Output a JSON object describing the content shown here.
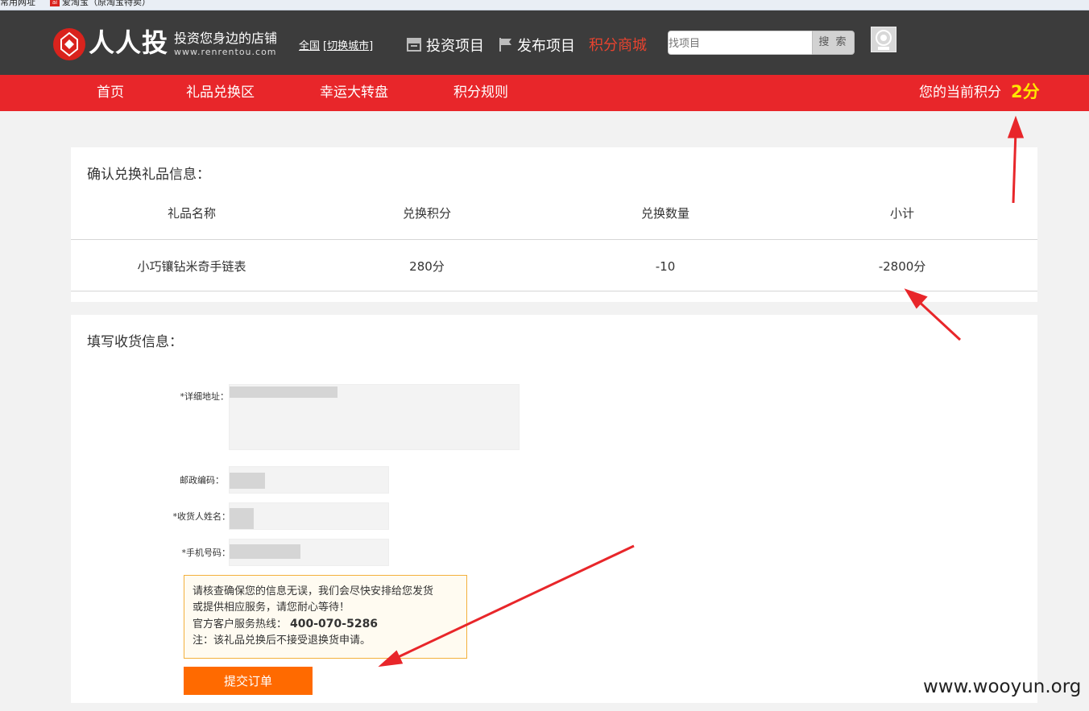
{
  "bookmarks": {
    "items": [
      {
        "label": "常用网址",
        "icon": "folder-icon"
      },
      {
        "label": "爱淘宝（原淘宝特卖）",
        "icon": "ai-taobao-icon"
      }
    ]
  },
  "header": {
    "logo_name": "人人投",
    "logo_slogan": "投资您身边的店铺",
    "logo_url": "www.renrentou.com",
    "city_current": "全国",
    "city_switch": "[切换城市]",
    "nav": [
      {
        "label": "投资项目",
        "icon": "shop-icon"
      },
      {
        "label": "发布项目",
        "icon": "flag-icon"
      },
      {
        "label": "积分商城",
        "active_color": "#e8432f"
      }
    ],
    "search_placeholder": "找项目",
    "search_button": "搜 索"
  },
  "rednav": {
    "items": [
      "首页",
      "礼品兑换区",
      "幸运大转盘",
      "积分规则"
    ],
    "points_label": "您的当前积分",
    "points_value": "2分",
    "bg_color": "#e8262a"
  },
  "confirm": {
    "title": "确认兑换礼品信息：",
    "columns": [
      "礼品名称",
      "兑换积分",
      "兑换数量",
      "小计"
    ],
    "rows": [
      [
        "小巧镶钻米奇手链表",
        "280分",
        "-10",
        "-2800分"
      ]
    ]
  },
  "shipping": {
    "title": "填写收货信息：",
    "fields": {
      "address_label": "*详细地址：",
      "zip_label": "邮政编码：",
      "name_label": "*收货人姓名：",
      "phone_label": "*手机号码："
    },
    "notice": {
      "line1": "请核查确保您的信息无误，我们会尽快安排给您发货",
      "line2": "或提供相应服务，请您耐心等待！",
      "hotline_label": "官方客户服务热线：",
      "hotline": "400-070-5286",
      "note": "注：该礼品兑换后不接受退换货申请。"
    },
    "submit_label": "提交订单"
  },
  "watermark": "www.wooyun.org",
  "colors": {
    "header_bg": "#3c3c3c",
    "accent_red": "#e8262a",
    "submit_orange": "#ff6a00",
    "points_yellow": "#ffe600"
  }
}
